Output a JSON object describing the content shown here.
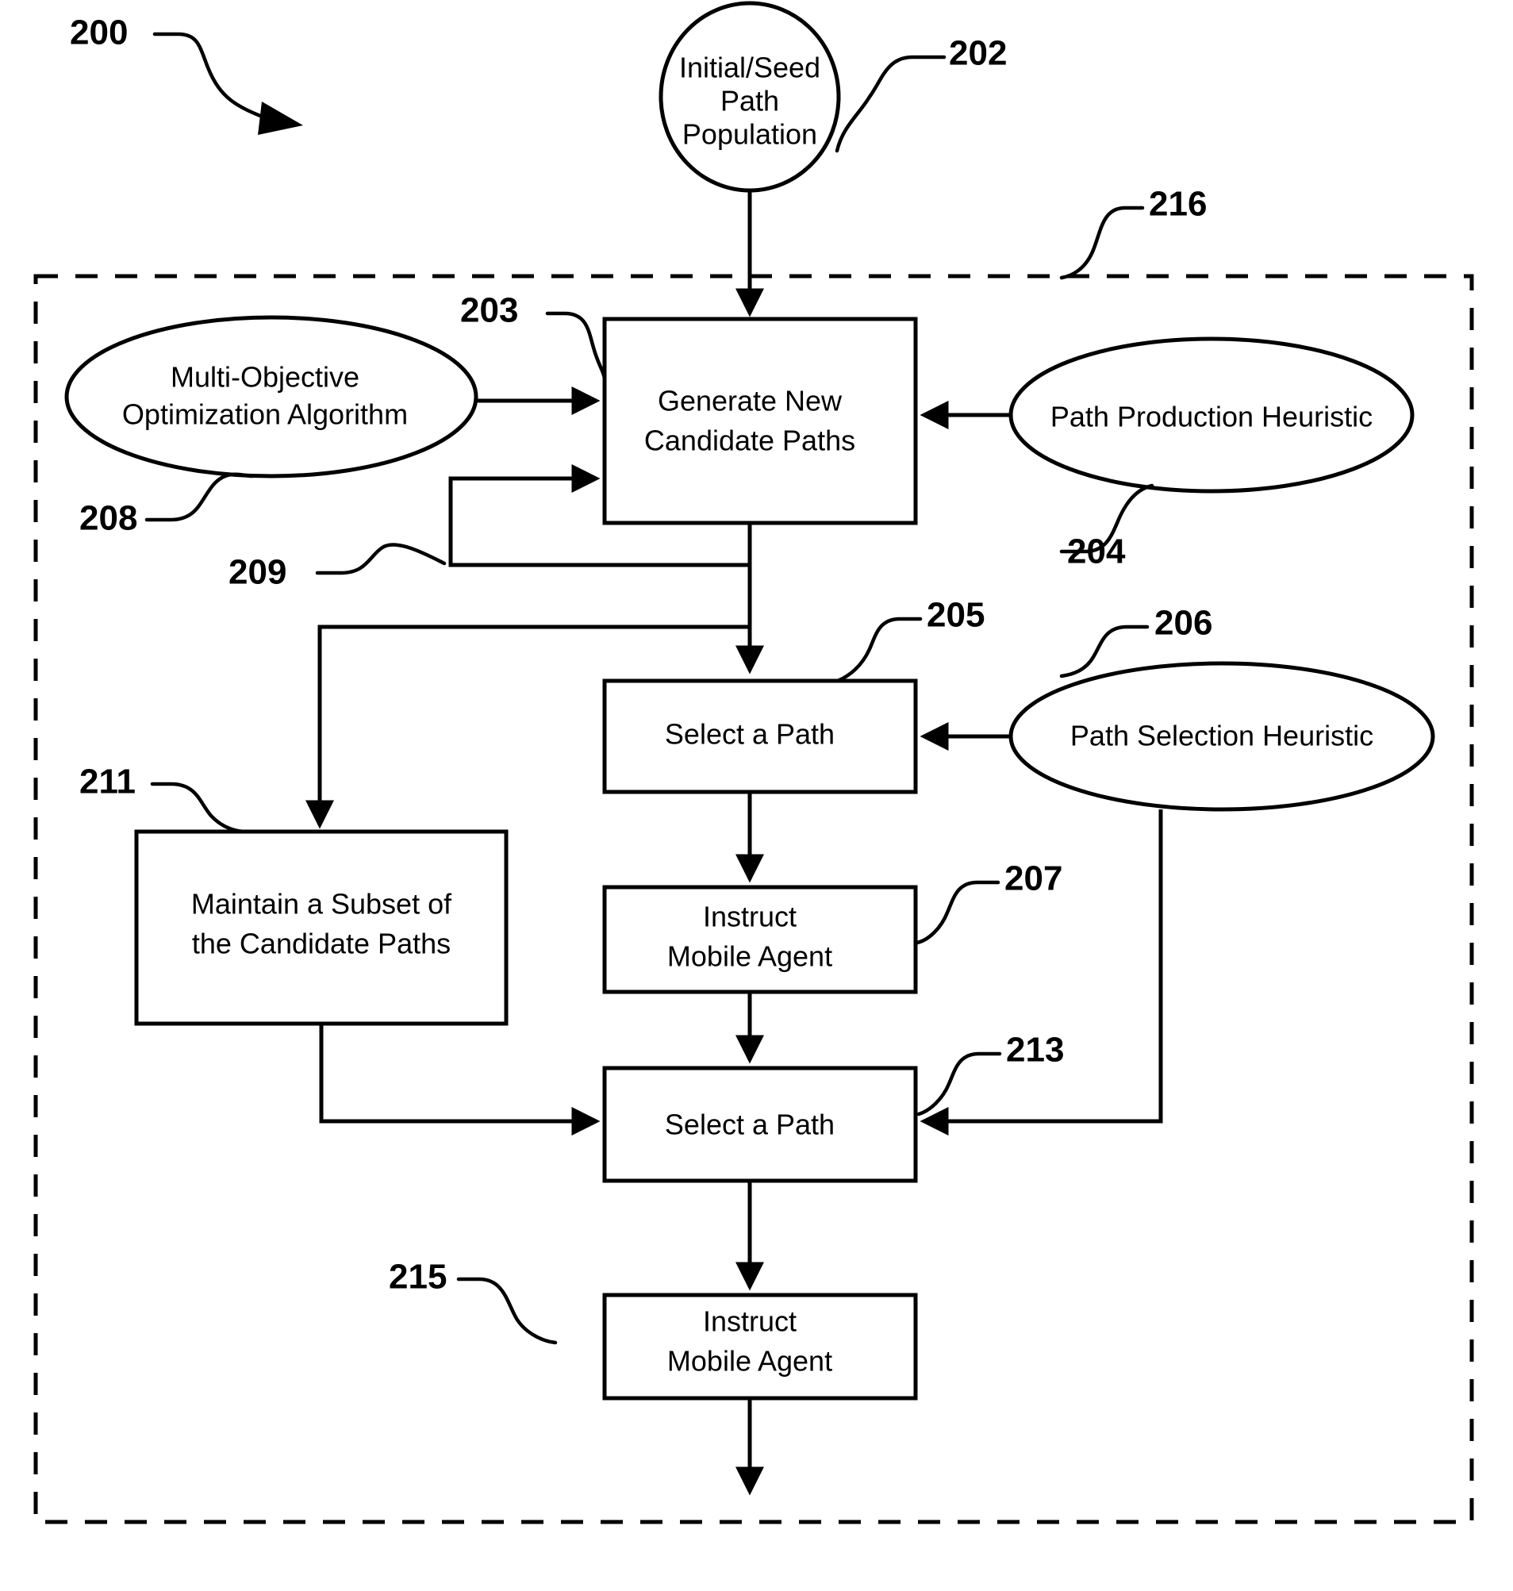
{
  "figure": {
    "figure_number": "200",
    "boundary_ref": "216",
    "nodes": {
      "seed_population": {
        "label_line1": "Initial/Seed",
        "label_line2": "Path",
        "label_line3": "Population",
        "ref": "202"
      },
      "generate_paths": {
        "label_line1": "Generate New",
        "label_line2": "Candidate Paths",
        "ref": "203"
      },
      "mo_algorithm": {
        "label_line1": "Multi-Objective",
        "label_line2": "Optimization Algorithm",
        "ref": "208"
      },
      "production_heuristic": {
        "label_line1": "Path Production Heuristic",
        "ref": "204"
      },
      "feedback_loop": {
        "ref": "209"
      },
      "select_path_1": {
        "label_line1": "Select a Path",
        "ref": "205"
      },
      "selection_heuristic": {
        "label_line1": "Path Selection Heuristic",
        "ref": "206"
      },
      "maintain_subset": {
        "label_line1": "Maintain a Subset of",
        "label_line2": "the Candidate Paths",
        "ref": "211"
      },
      "instruct_agent_1": {
        "label_line1": "Instruct",
        "label_line2": "Mobile Agent",
        "ref": "207"
      },
      "select_path_2": {
        "label_line1": "Select a Path",
        "ref": "213"
      },
      "instruct_agent_2": {
        "label_line1": "Instruct",
        "label_line2": "Mobile Agent",
        "ref": "215"
      }
    },
    "colors": {
      "ink": "#000000",
      "paper": "#ffffff"
    }
  }
}
